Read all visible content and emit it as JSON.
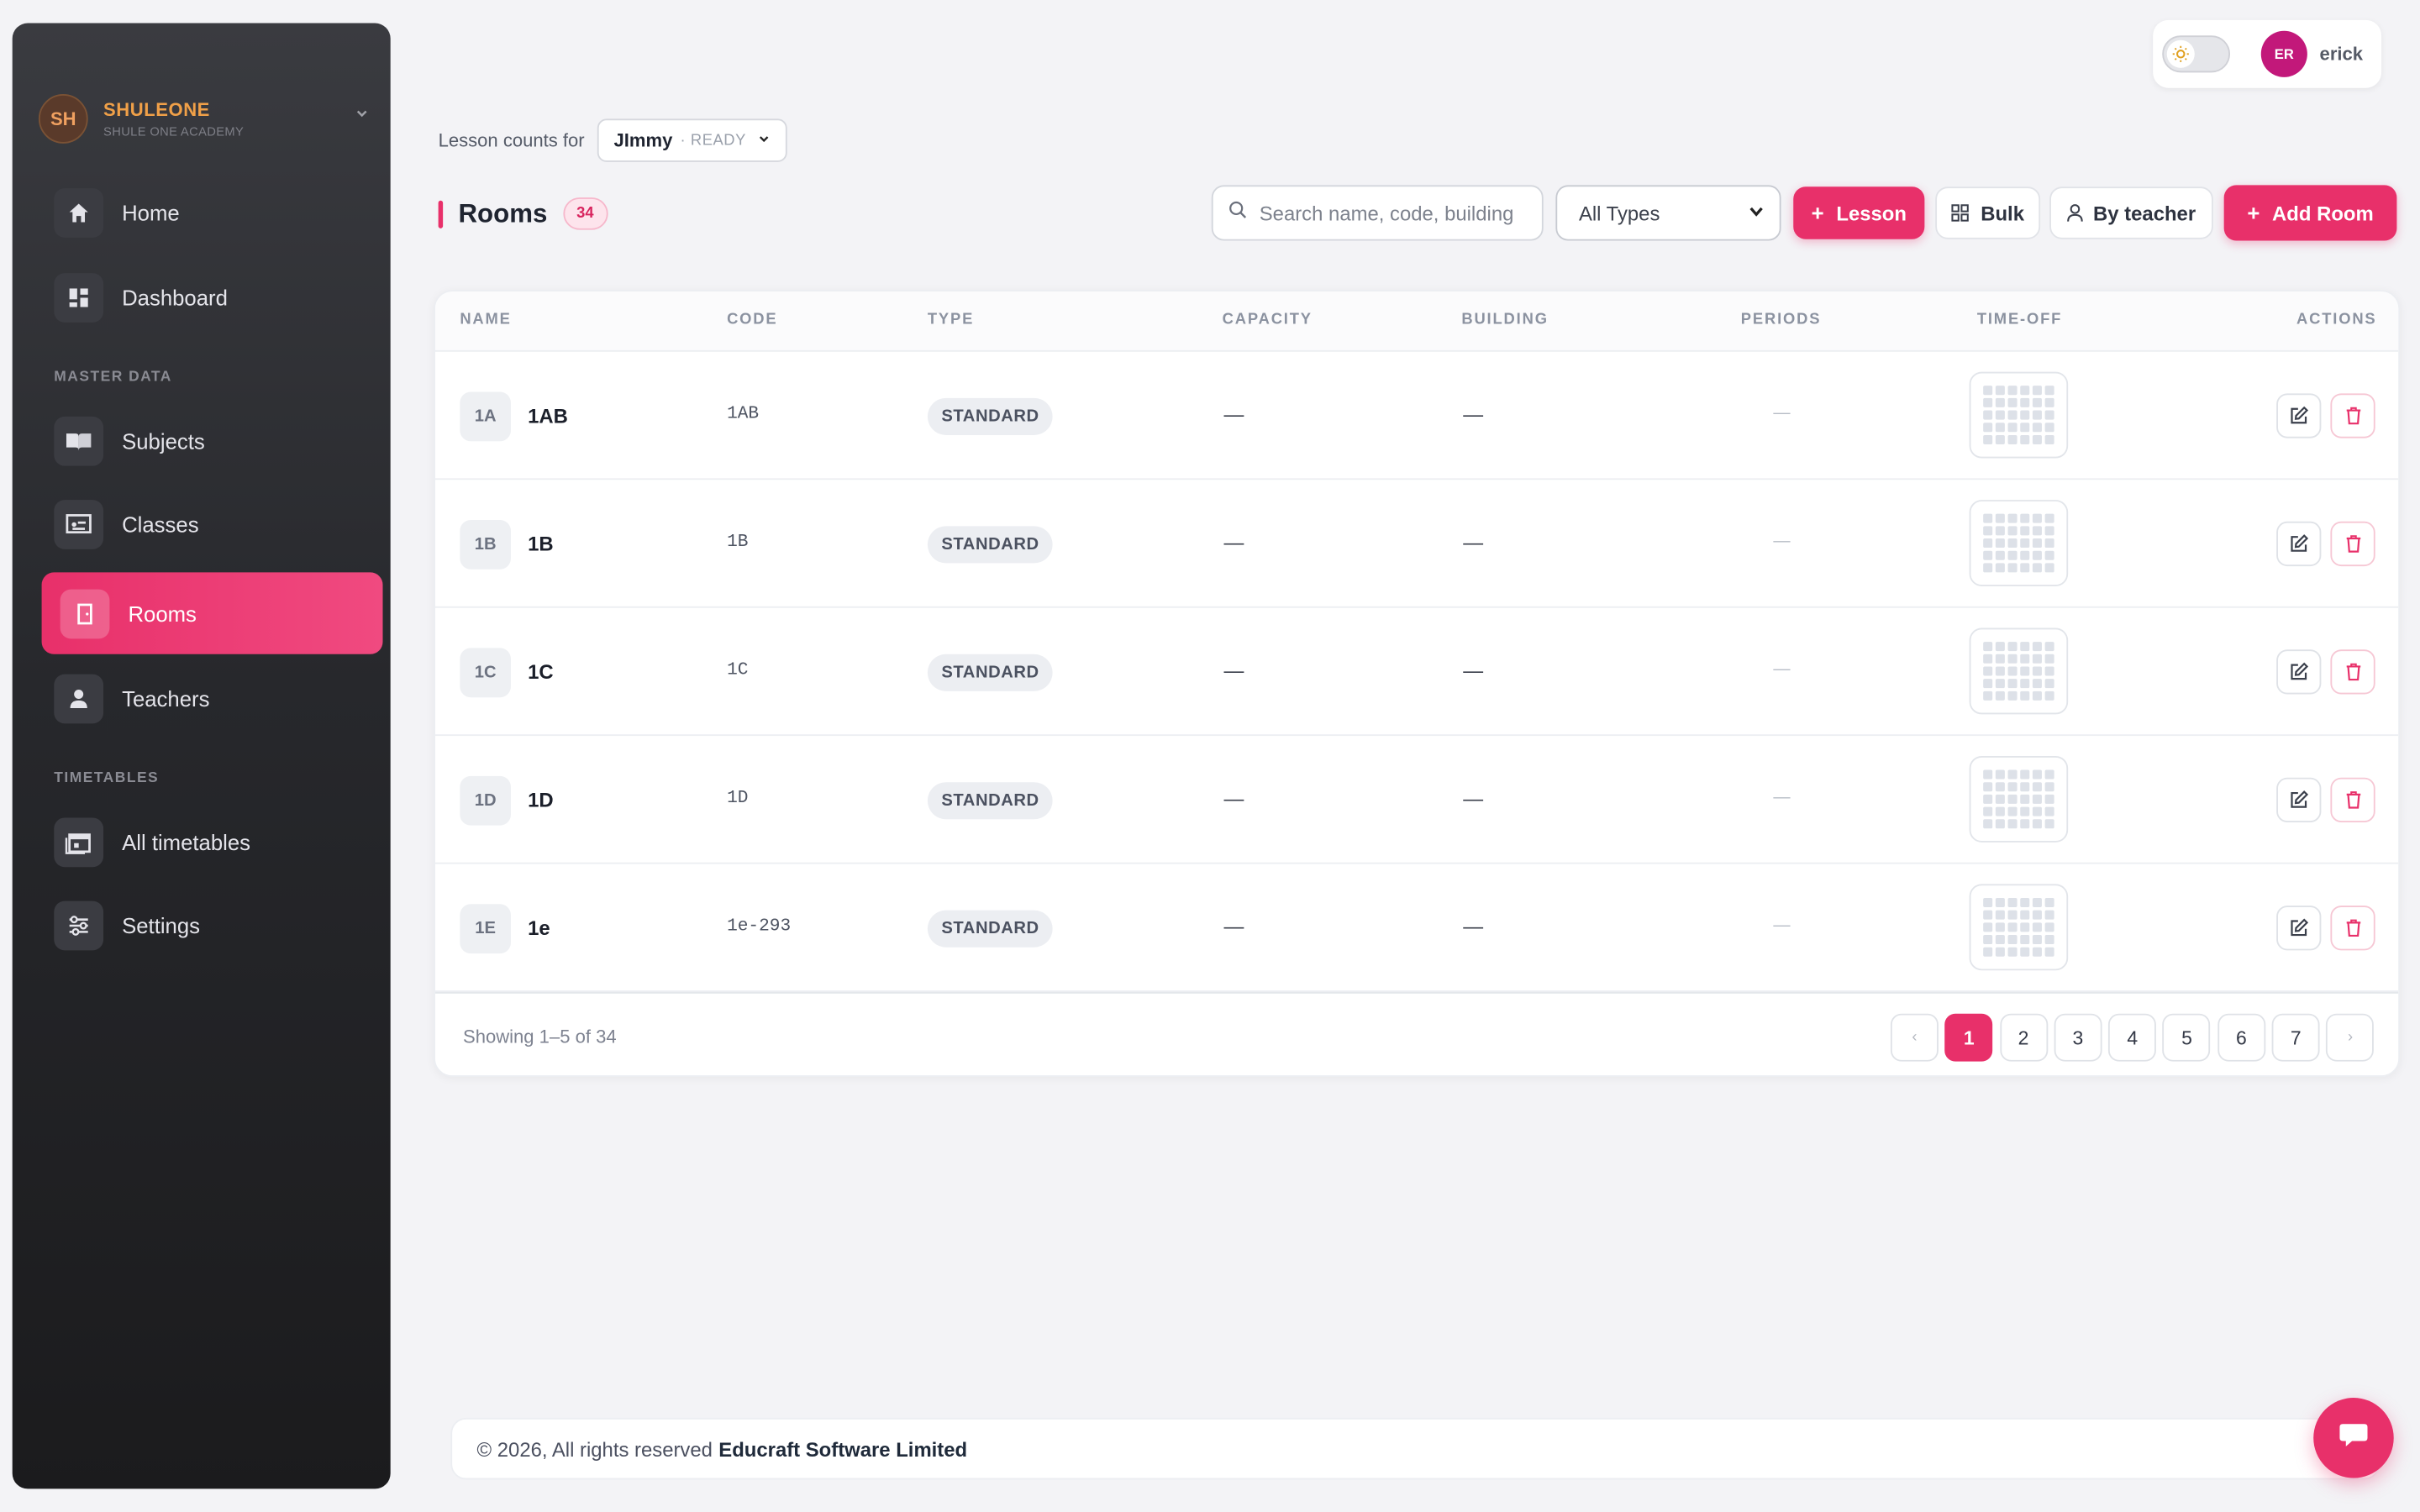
{
  "brand": {
    "initials": "SH",
    "name": "SHULEONE",
    "subtitle": "SHULE ONE ACADEMY"
  },
  "sidebar": {
    "sections": {
      "master_data": "MASTER DATA",
      "timetables": "TIMETABLES"
    },
    "items": [
      {
        "label": "Home",
        "icon": "home-icon"
      },
      {
        "label": "Dashboard",
        "icon": "dashboard-icon"
      },
      {
        "label": "Subjects",
        "icon": "book-icon"
      },
      {
        "label": "Classes",
        "icon": "classroom-icon"
      },
      {
        "label": "Rooms",
        "icon": "door-icon",
        "active": true
      },
      {
        "label": "Teachers",
        "icon": "teacher-icon"
      },
      {
        "label": "All timetables",
        "icon": "calendar-icon"
      },
      {
        "label": "Settings",
        "icon": "sliders-icon"
      }
    ]
  },
  "user": {
    "initials": "ER",
    "name": "erick",
    "theme": "light"
  },
  "lesson_counts": {
    "label": "Lesson counts for",
    "name": "JImmy",
    "status": "· READY"
  },
  "toolbar": {
    "title": "Rooms",
    "count": "34",
    "search_placeholder": "Search name, code, building",
    "type_filter": "All Types",
    "lesson_button": "Lesson",
    "bulk_button": "Bulk",
    "by_teacher_button": "By teacher",
    "add_room_button": "Add Room"
  },
  "table": {
    "columns": [
      "NAME",
      "CODE",
      "TYPE",
      "CAPACITY",
      "BUILDING",
      "PERIODS",
      "TIME-OFF",
      "ACTIONS"
    ],
    "rows": [
      {
        "badge": "1A",
        "name": "1AB",
        "code": "1AB",
        "type": "STANDARD",
        "capacity": "—",
        "building": "—",
        "periods": "—"
      },
      {
        "badge": "1B",
        "name": "1B",
        "code": "1B",
        "type": "STANDARD",
        "capacity": "—",
        "building": "—",
        "periods": "—"
      },
      {
        "badge": "1C",
        "name": "1C",
        "code": "1C",
        "type": "STANDARD",
        "capacity": "—",
        "building": "—",
        "periods": "—"
      },
      {
        "badge": "1D",
        "name": "1D",
        "code": "1D",
        "type": "STANDARD",
        "capacity": "—",
        "building": "—",
        "periods": "—"
      },
      {
        "badge": "1E",
        "name": "1e",
        "code": "1e-293",
        "type": "STANDARD",
        "capacity": "—",
        "building": "—",
        "periods": "—"
      }
    ]
  },
  "pagination": {
    "showing": "Showing 1–5 of 34",
    "prev": "‹",
    "next": "›",
    "pages": [
      "1",
      "2",
      "3",
      "4",
      "5",
      "6",
      "7"
    ],
    "current": "1"
  },
  "footer": {
    "text": "© 2026, All rights reserved",
    "company": "Educraft Software Limited"
  },
  "colors": {
    "accent": "#e8306a",
    "sidebar_bg": "#27282c",
    "brand_orange": "#f0a048"
  }
}
